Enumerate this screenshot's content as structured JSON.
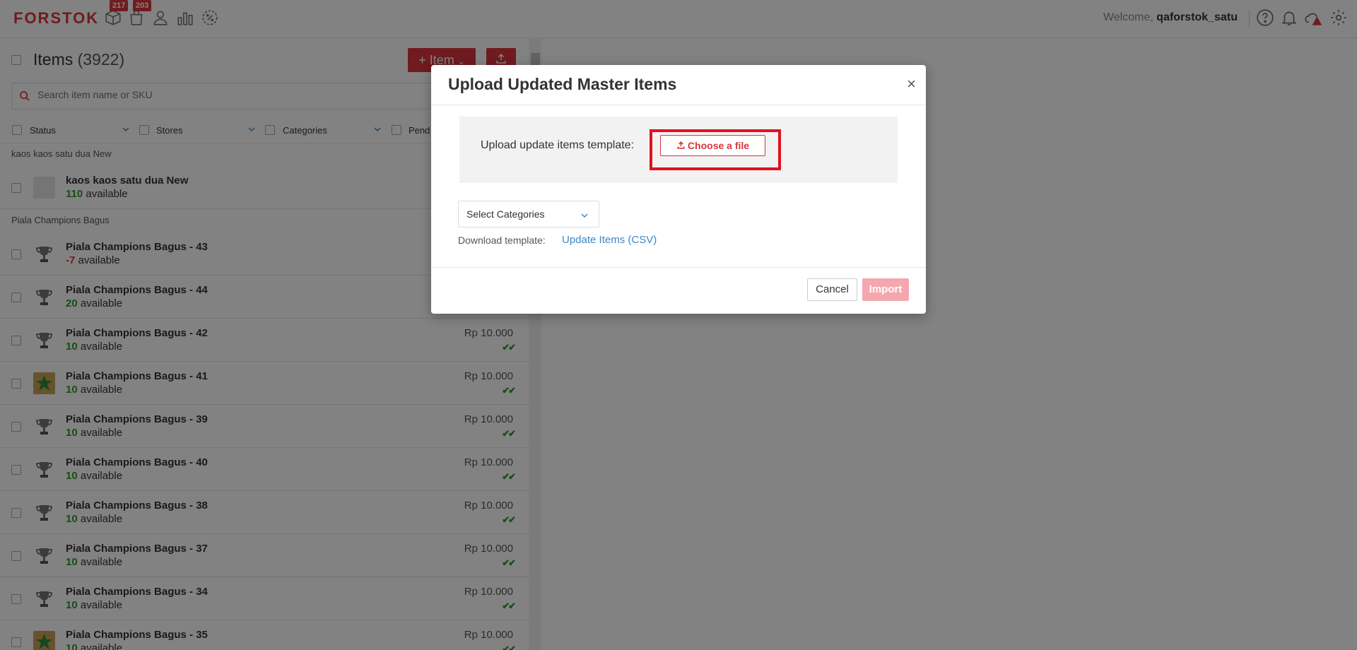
{
  "app": {
    "logo": "FORSTOK",
    "badges": {
      "orders": "217",
      "notifications": "203"
    },
    "welcome_prefix": "Welcome,",
    "username": "qaforstok_satu"
  },
  "items": {
    "title": "Items",
    "count": "(3922)",
    "add_button": "+ Item",
    "search_placeholder": "Search item name or SKU",
    "filters": [
      "Status",
      "Stores",
      "Categories",
      "Pend"
    ],
    "groups": [
      {
        "label": "kaos kaos satu dua New",
        "rows": [
          {
            "name": "kaos kaos satu dua New",
            "qty": "110",
            "avail_label": "available",
            "price": "",
            "thumb": "blank"
          }
        ]
      },
      {
        "label": "Piala Champions Bagus",
        "rows": [
          {
            "name": "Piala Champions Bagus - 43",
            "qty": "-7",
            "avail_label": "available",
            "price": "",
            "thumb": "trophy"
          },
          {
            "name": "Piala Champions Bagus - 44",
            "qty": "20",
            "avail_label": "available",
            "price": "",
            "thumb": "trophy"
          },
          {
            "name": "Piala Champions Bagus - 42",
            "qty": "10",
            "avail_label": "available",
            "price": "Rp 10.000",
            "thumb": "trophy"
          },
          {
            "name": "Piala Champions Bagus - 41",
            "qty": "10",
            "avail_label": "available",
            "price": "Rp 10.000",
            "thumb": "star"
          },
          {
            "name": "Piala Champions Bagus - 39",
            "qty": "10",
            "avail_label": "available",
            "price": "Rp 10.000",
            "thumb": "trophy"
          },
          {
            "name": "Piala Champions Bagus - 40",
            "qty": "10",
            "avail_label": "available",
            "price": "Rp 10.000",
            "thumb": "trophy"
          },
          {
            "name": "Piala Champions Bagus - 38",
            "qty": "10",
            "avail_label": "available",
            "price": "Rp 10.000",
            "thumb": "trophy"
          },
          {
            "name": "Piala Champions Bagus - 37",
            "qty": "10",
            "avail_label": "available",
            "price": "Rp 10.000",
            "thumb": "trophy"
          },
          {
            "name": "Piala Champions Bagus - 34",
            "qty": "10",
            "avail_label": "available",
            "price": "Rp 10.000",
            "thumb": "trophy"
          },
          {
            "name": "Piala Champions Bagus - 35",
            "qty": "10",
            "avail_label": "available",
            "price": "Rp 10.000",
            "thumb": "star"
          }
        ]
      }
    ]
  },
  "modal": {
    "title": "Upload Updated Master Items",
    "close": "×",
    "upload_label": "Upload update items template:",
    "choose_file": "Choose a file",
    "select_categories": "Select Categories",
    "download_label": "Download template:",
    "download_link": "Update Items (CSV)",
    "cancel": "Cancel",
    "import": "Import"
  },
  "colors": {
    "brand": "#d9363e",
    "available": "#2e9a2e",
    "link": "#3b87c8",
    "highlight": "#e0121f"
  }
}
